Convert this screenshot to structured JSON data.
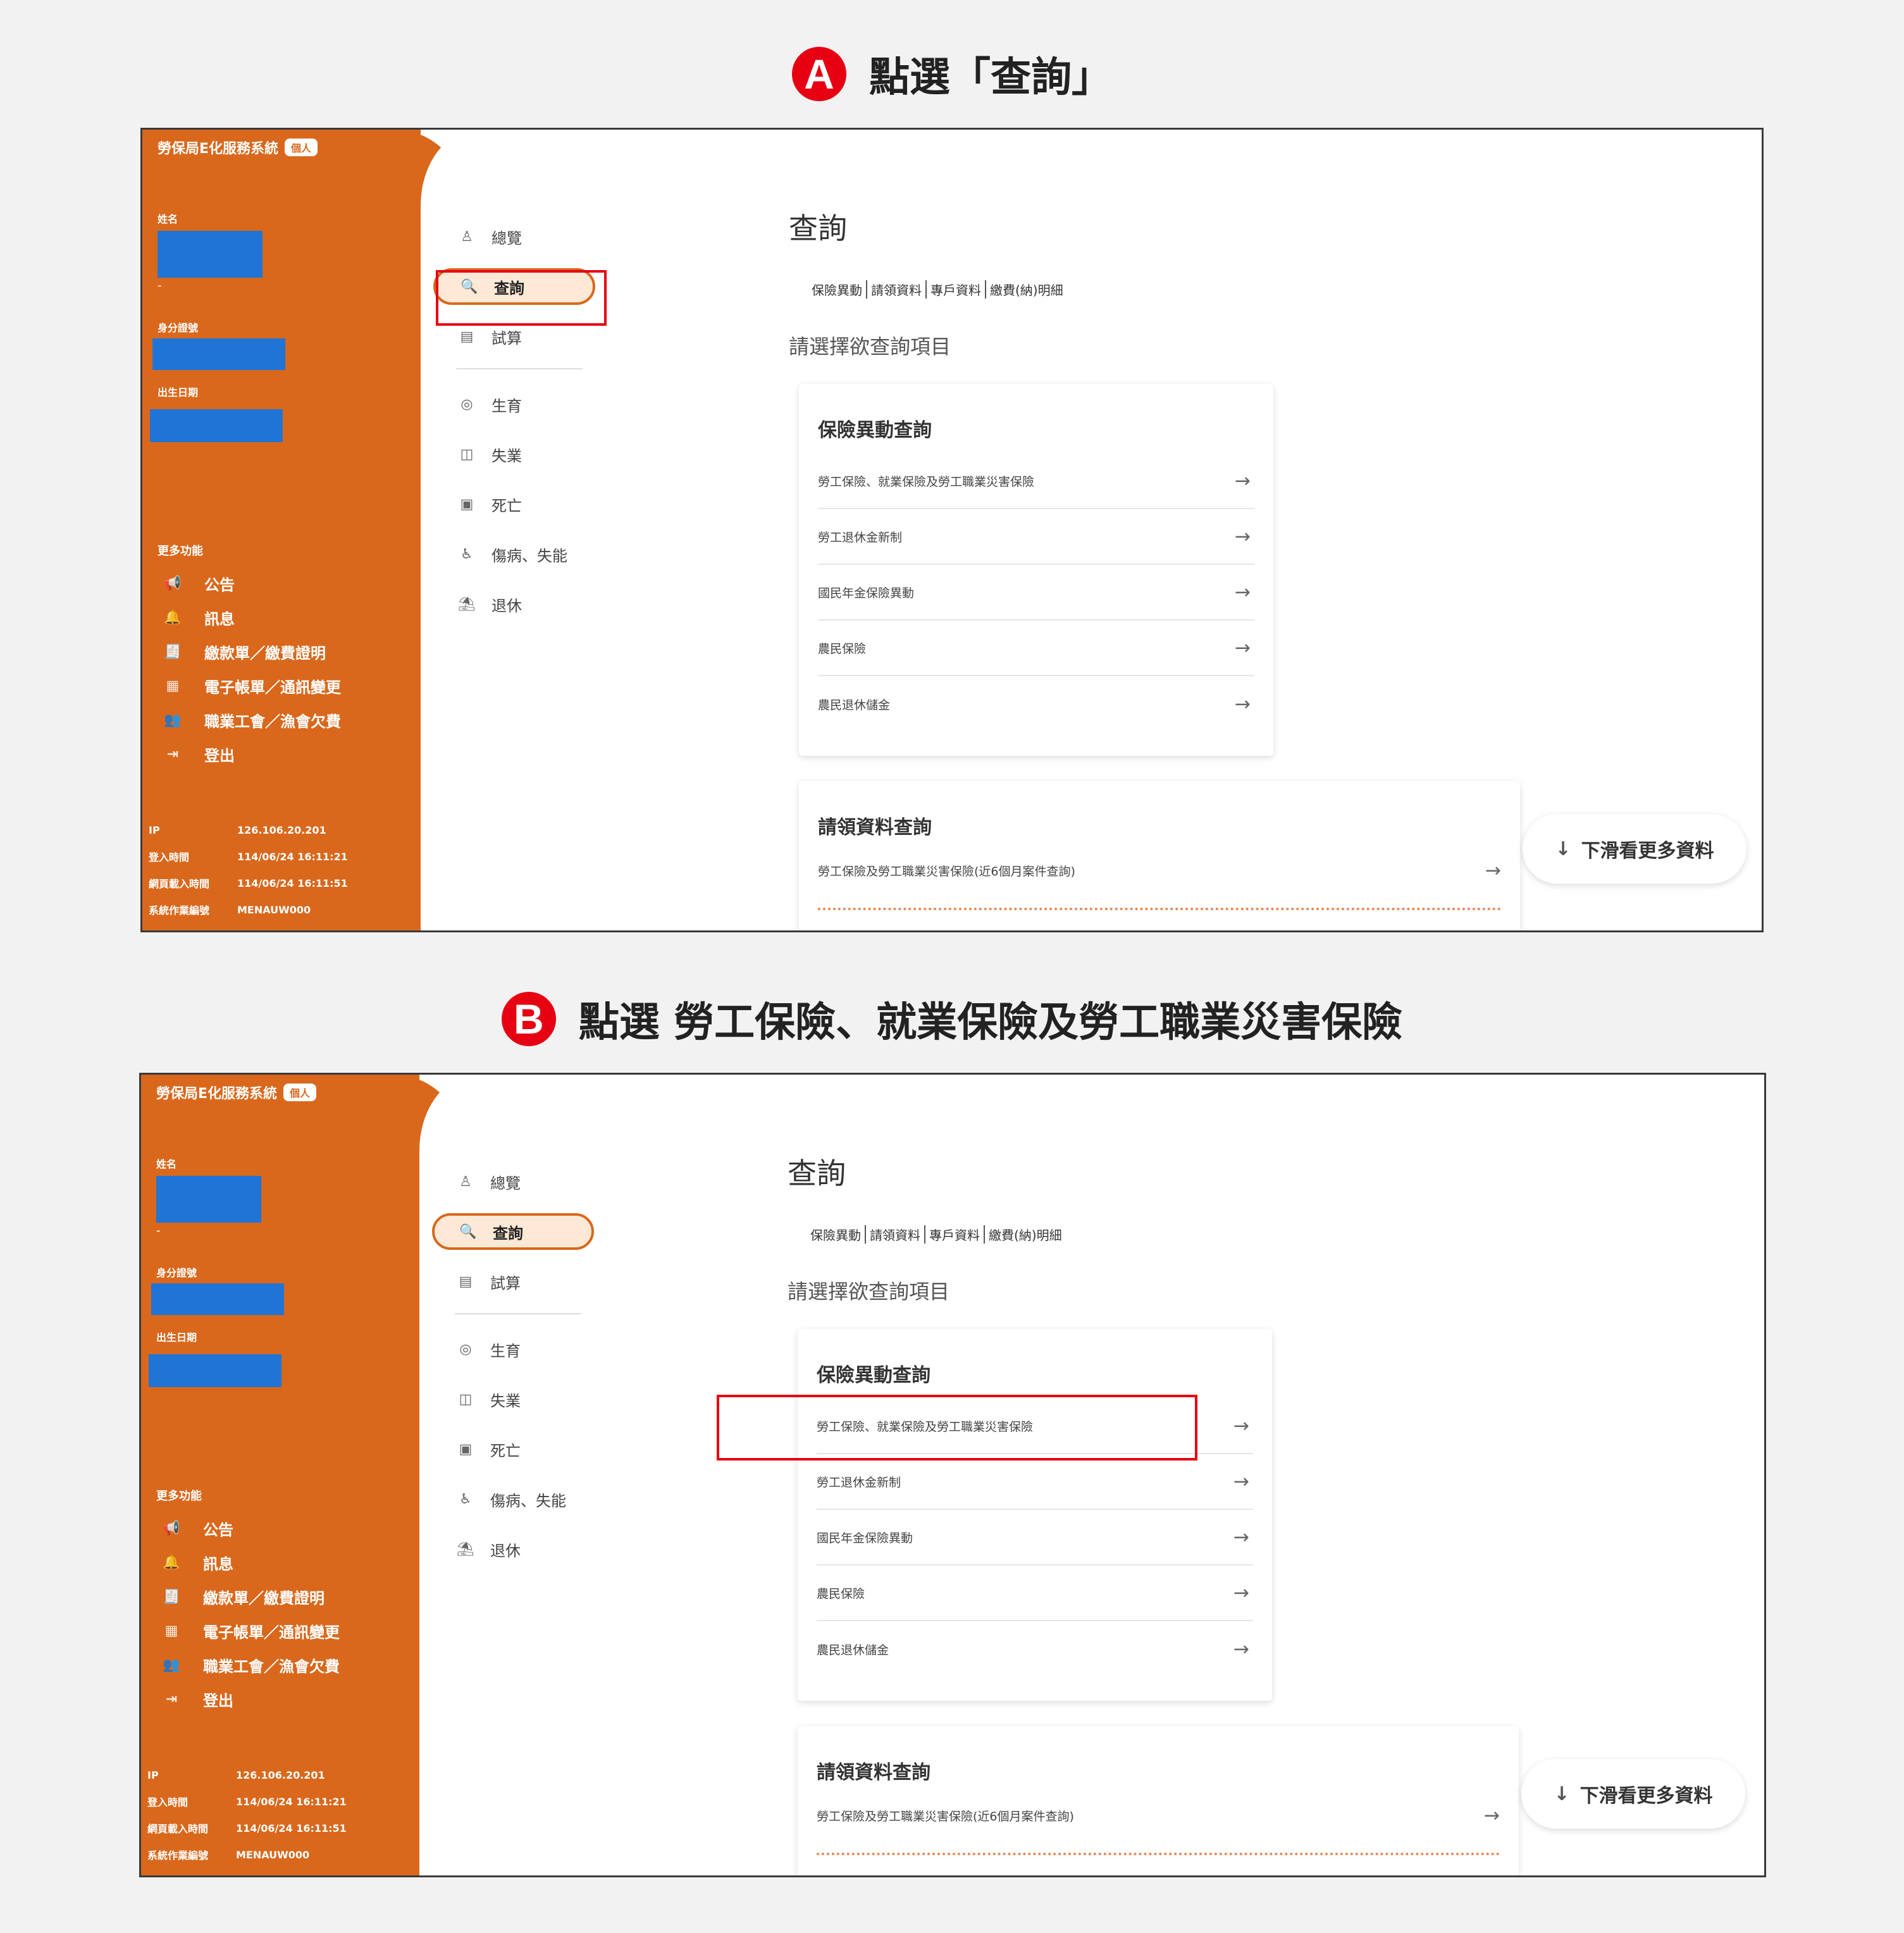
{
  "steps": [
    {
      "badge": "A",
      "title": "點選「查詢」"
    },
    {
      "badge": "B",
      "title": "點選 勞工保險、就業保險及勞工職業災害保險"
    }
  ],
  "app": {
    "title": "勞保局E化服務系統",
    "badge": "個人",
    "fields": {
      "name": "姓名",
      "id": "身分證號",
      "birth": "出生日期",
      "dash": "-"
    },
    "more_label": "更多功能",
    "side_menu": [
      {
        "icon": "megaphone-icon",
        "glyph": "📢",
        "label": "公告"
      },
      {
        "icon": "bell-icon",
        "glyph": "🔔",
        "label": "訊息"
      },
      {
        "icon": "bill-icon",
        "glyph": "🧾",
        "label": "繳款單／繳費證明"
      },
      {
        "icon": "ebill-icon",
        "glyph": "▦",
        "label": "電子帳單／通訊變更"
      },
      {
        "icon": "union-icon",
        "glyph": "👥",
        "label": "職業工會／漁會欠費"
      },
      {
        "icon": "logout-icon",
        "glyph": "⇥",
        "label": "登出"
      }
    ],
    "meta": [
      {
        "k": "IP",
        "v": "126.106.20.201"
      },
      {
        "k": "登入時間",
        "v": "114/06/24 16:11:21"
      },
      {
        "k": "網頁載入時間",
        "v": "114/06/24 16:11:51"
      },
      {
        "k": "系統作業編號",
        "v": "MENAUW000"
      }
    ],
    "nav_top": [
      {
        "icon": "overview-icon",
        "glyph": "♙",
        "label": "總覽"
      },
      {
        "icon": "search-icon",
        "glyph": "🔍",
        "label": "查詢"
      },
      {
        "icon": "calculator-icon",
        "glyph": "▤",
        "label": "試算"
      }
    ],
    "nav_bottom": [
      {
        "icon": "birth-icon",
        "glyph": "◎",
        "label": "生育"
      },
      {
        "icon": "unemployment-icon",
        "glyph": "◫",
        "label": "失業"
      },
      {
        "icon": "death-icon",
        "glyph": "▣",
        "label": "死亡"
      },
      {
        "icon": "injury-icon",
        "glyph": "♿",
        "label": "傷病、失能"
      },
      {
        "icon": "retire-icon",
        "glyph": "⛱",
        "label": "退休"
      }
    ],
    "main_title": "查詢",
    "tabs": [
      "保險異動",
      "請領資料",
      "專戶資料",
      "繳費(納)明細"
    ],
    "prompt": "請選擇欲查詢項目",
    "card1": {
      "title": "保險異動查詢",
      "rows": [
        "勞工保險、就業保險及勞工職業災害保險",
        "勞工退休金新制",
        "國民年金保險異動",
        "農民保險",
        "農民退休儲金"
      ]
    },
    "card2": {
      "title": "請領資料查詢",
      "row": "勞工保險及勞工職業災害保險(近6個月案件查詢)"
    },
    "arrow": "→",
    "scroll_hint": "下滑看更多資料",
    "scroll_icon": "↓"
  },
  "colors": {
    "accent": "#d9681c",
    "highlight": "#e60012",
    "redact": "#1f74d6"
  }
}
